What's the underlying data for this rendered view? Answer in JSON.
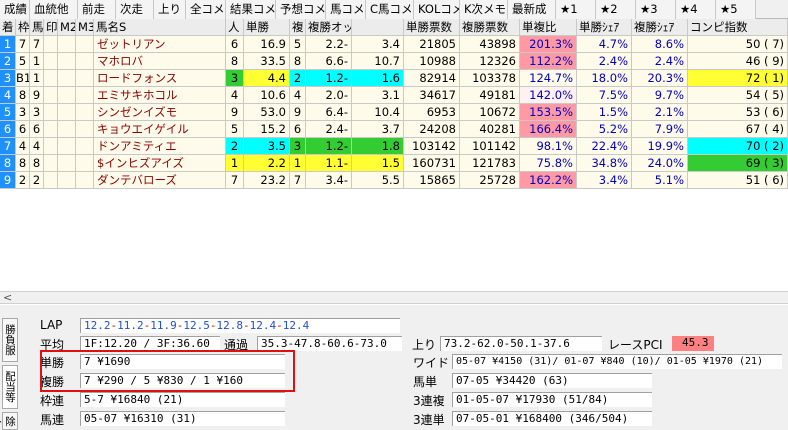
{
  "tabs": [
    "成績",
    "血統他",
    "前走",
    "次走",
    "上り",
    "全コメ",
    "結果コメ",
    "予想コメ",
    "馬コメ",
    "C馬コメ",
    "KOLコメ",
    "K次メモ",
    "最新成",
    "★1",
    "★2",
    "★3",
    "★4",
    "★5"
  ],
  "columns": [
    "着",
    "枠",
    "馬",
    "印",
    "M2",
    "M3",
    "馬名S",
    "人",
    "単勝",
    "複",
    "複勝オッズ",
    "",
    "単勝票数",
    "複勝票数",
    "単複比",
    "単勝ｼｪｱ",
    "複勝ｼｪｱ",
    "コンピ指数"
  ],
  "rows": [
    {
      "no": "1",
      "waku": "7",
      "uma": "7",
      "shirushi": "",
      "m2": "",
      "m3": "",
      "name": "ゼットリアン",
      "ninki": "6",
      "tansho": "16.9",
      "fuku": "5",
      "fmin": "2.2-",
      "fmax": "3.4",
      "tvotes": "21805",
      "fvotes": "43898",
      "ratio": "201.3%",
      "tshare": "4.7%",
      "fshare": "8.6%",
      "compi": "50 ( 7)"
    },
    {
      "no": "2",
      "waku": "5",
      "uma": "1",
      "shirushi": "",
      "m2": "",
      "m3": "",
      "name": "マホロバ",
      "ninki": "8",
      "tansho": "33.5",
      "fuku": "8",
      "fmin": "6.6-",
      "fmax": "10.7",
      "tvotes": "10988",
      "fvotes": "12326",
      "ratio": "112.2%",
      "tshare": "2.4%",
      "fshare": "2.4%",
      "compi": "46 ( 9)"
    },
    {
      "no": "3",
      "waku": "B1",
      "uma": "1",
      "shirushi": "",
      "m2": "",
      "m3": "",
      "name": "ロードフォンス",
      "ninki": "3",
      "tansho": "4.4",
      "fuku": "2",
      "fmin": "1.2-",
      "fmax": "1.6",
      "tvotes": "82914",
      "fvotes": "103378",
      "ratio": "124.7%",
      "tshare": "18.0%",
      "fshare": "20.3%",
      "compi": "72 ( 1)"
    },
    {
      "no": "4",
      "waku": "8",
      "uma": "9",
      "shirushi": "",
      "m2": "",
      "m3": "",
      "name": "エミサキホコル",
      "ninki": "4",
      "tansho": "10.6",
      "fuku": "4",
      "fmin": "2.0-",
      "fmax": "3.1",
      "tvotes": "34617",
      "fvotes": "49181",
      "ratio": "142.0%",
      "tshare": "7.5%",
      "fshare": "9.7%",
      "compi": "54 ( 5)"
    },
    {
      "no": "5",
      "waku": "3",
      "uma": "3",
      "shirushi": "",
      "m2": "",
      "m3": "",
      "name": "シンゼンイズモ",
      "ninki": "9",
      "tansho": "53.0",
      "fuku": "9",
      "fmin": "6.4-",
      "fmax": "10.4",
      "tvotes": "6953",
      "fvotes": "10672",
      "ratio": "153.5%",
      "tshare": "1.5%",
      "fshare": "2.1%",
      "compi": "53 ( 6)"
    },
    {
      "no": "6",
      "waku": "6",
      "uma": "6",
      "shirushi": "",
      "m2": "",
      "m3": "",
      "name": "キョウエイゲイル",
      "ninki": "5",
      "tansho": "15.2",
      "fuku": "6",
      "fmin": "2.4-",
      "fmax": "3.7",
      "tvotes": "24208",
      "fvotes": "40281",
      "ratio": "166.4%",
      "tshare": "5.2%",
      "fshare": "7.9%",
      "compi": "67 ( 4)"
    },
    {
      "no": "7",
      "waku": "4",
      "uma": "4",
      "shirushi": "",
      "m2": "",
      "m3": "",
      "name": "ドンアミティエ",
      "ninki": "2",
      "tansho": "3.5",
      "fuku": "3",
      "fmin": "1.2-",
      "fmax": "1.8",
      "tvotes": "103142",
      "fvotes": "101142",
      "ratio": "98.1%",
      "tshare": "22.4%",
      "fshare": "19.9%",
      "compi": "70 ( 2)"
    },
    {
      "no": "8",
      "waku": "8",
      "uma": "8",
      "shirushi": "",
      "m2": "",
      "m3": "",
      "name": "$インヒズアイズ",
      "ninki": "1",
      "tansho": "2.2",
      "fuku": "1",
      "fmin": "1.1-",
      "fmax": "1.5",
      "tvotes": "160731",
      "fvotes": "121783",
      "ratio": "75.8%",
      "tshare": "34.8%",
      "fshare": "24.0%",
      "compi": "69 ( 3)"
    },
    {
      "no": "9",
      "waku": "2",
      "uma": "2",
      "shirushi": "",
      "m2": "",
      "m3": "",
      "name": "ダンテバローズ",
      "ninki": "7",
      "tansho": "23.2",
      "fuku": "7",
      "fmin": "3.4-",
      "fmax": "5.5",
      "tvotes": "15865",
      "fvotes": "25728",
      "ratio": "162.2%",
      "tshare": "3.4%",
      "fshare": "5.1%",
      "compi": "51 ( 6)"
    }
  ],
  "colors": {
    "row_num_bg": "#1e90ff",
    "cyan": "#00ffff",
    "green": "#33cc33",
    "yellow": "#ffff33",
    "ratio_pink": "#ff9aa5",
    "row_bg": "#fffbea",
    "pci_bg": "#ff8080",
    "highlight_frame": "#e01010"
  },
  "side_tabs": {
    "t1": "勝負服",
    "t2": "配当等",
    "t3": "除外馬"
  },
  "result": {
    "lap_label": "LAP",
    "lap_values": [
      "12.2",
      "11.2",
      "11.9",
      "12.5",
      "12.8",
      "12.4",
      "12.4"
    ],
    "avg_label": "平均",
    "avg_value": "1F:12.20 / 3F:36.60",
    "pass_label": "通過",
    "pass_value": "35.3-47.8-60.6-73.0",
    "agari_label": "上り",
    "agari_value": "73.2-62.0-50.1-37.6",
    "pci_label": "レースPCI",
    "pci_value": "45.3",
    "tansho_label": "単勝",
    "tansho_value": "7 ¥1690",
    "fukusho_label": "複勝",
    "fukusho_value": "7 ¥290 / 5 ¥830 / 1 ¥160",
    "wakuren_label": "枠連",
    "wakuren_value": "5-7 ¥16840 (21)",
    "umaren_label": "馬連",
    "umaren_value": "05-07 ¥16310 (31)",
    "wide_label": "ワイド",
    "wide_value": "05-07 ¥4150 (31)/ 01-07 ¥840 (10)/ 01-05 ¥1970 (21)",
    "umatan_label": "馬単",
    "umatan_value": "07-05 ¥34420 (63)",
    "sanrenpuku_label": "3連複",
    "sanrenpuku_value": "01-05-07 ¥17930 (51/84)",
    "sanrentan_label": "3連単",
    "sanrentan_value": "07-05-01 ¥168400 (346/504)"
  }
}
